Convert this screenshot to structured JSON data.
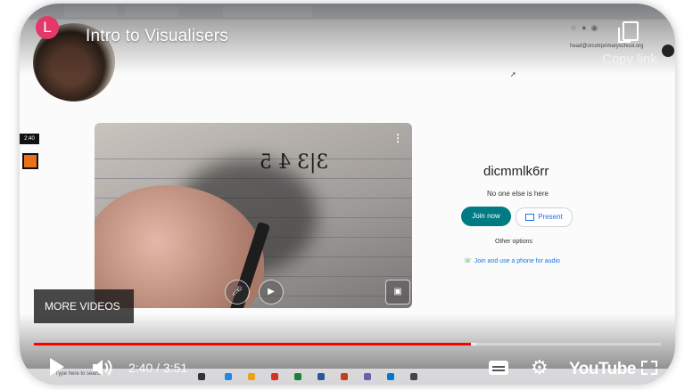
{
  "video": {
    "title": "Intro to Visualisers",
    "channel_initial": "L",
    "copy_link_label": "Copy link",
    "more_videos_label": "MORE VIDEOS",
    "time_display": "2:40 / 3:51",
    "progress_fraction": 0.697,
    "buffered_fraction": 0.705,
    "youtube_logo": "YouTube",
    "accent_color": "#ff0000",
    "icons": [
      "play-icon",
      "volume-icon",
      "captions-icon",
      "gear-icon",
      "fullscreen-icon",
      "copy-icon"
    ]
  },
  "meet": {
    "user_email": "head@orcotrprimaryschool.org",
    "meeting_code": "dicmmlk6rr",
    "status": "No one else is here",
    "join_label": "Join now",
    "present_label": "Present",
    "other_options": "Other options",
    "phone_option": "Join and use a phone for audio",
    "recording_badge": "2:40",
    "handwriting": "3|3 4 5",
    "join_color": "#007b83"
  },
  "taskbar": {
    "search_placeholder": "Type here to search"
  }
}
